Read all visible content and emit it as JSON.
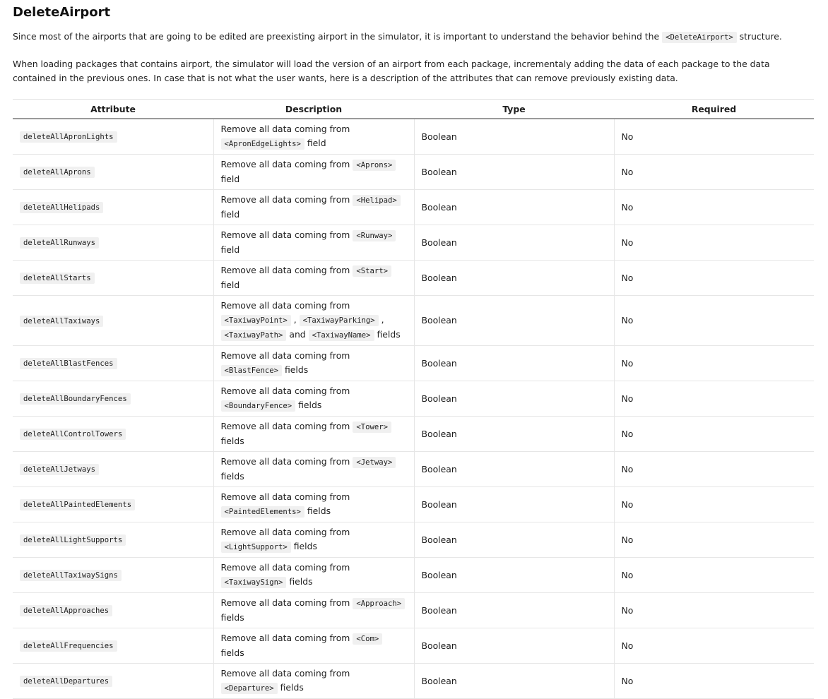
{
  "title": "DeleteAirport",
  "intro": {
    "p1_before": "Since most of the airports that are going to be edited are preexisting airport in the simulator, it is important to understand the behavior behind the ",
    "p1_code": "<DeleteAirport>",
    "p1_after": " structure.",
    "p2": "When loading packages that contains airport, the simulator will load the version of an airport from each package, incrementaly adding the data of each package to the data contained in the previous ones. In case that is not what the user wants, here is a description of the attributes that can remove previously existing data."
  },
  "table": {
    "headers": [
      "Attribute",
      "Description",
      "Type",
      "Required"
    ],
    "rows": [
      {
        "attr": "deleteAllApronLights",
        "desc": [
          {
            "t": "Remove all data coming from "
          },
          {
            "c": "<ApronEdgeLights>"
          },
          {
            "t": " field"
          }
        ],
        "type": "Boolean",
        "req": "No"
      },
      {
        "attr": "deleteAllAprons",
        "desc": [
          {
            "t": "Remove all data coming from "
          },
          {
            "c": "<Aprons>"
          },
          {
            "t": " field"
          }
        ],
        "type": "Boolean",
        "req": "No"
      },
      {
        "attr": "deleteAllHelipads",
        "desc": [
          {
            "t": "Remove all data coming from "
          },
          {
            "c": "<Helipad>"
          },
          {
            "t": " field"
          }
        ],
        "type": "Boolean",
        "req": "No"
      },
      {
        "attr": "deleteAllRunways",
        "desc": [
          {
            "t": "Remove all data coming from "
          },
          {
            "c": "<Runway>"
          },
          {
            "t": " field"
          }
        ],
        "type": "Boolean",
        "req": "No"
      },
      {
        "attr": "deleteAllStarts",
        "desc": [
          {
            "t": "Remove all data coming from "
          },
          {
            "c": "<Start>"
          },
          {
            "t": " field"
          }
        ],
        "type": "Boolean",
        "req": "No"
      },
      {
        "attr": "deleteAllTaxiways",
        "desc": [
          {
            "t": "Remove all data coming from "
          },
          {
            "c": "<TaxiwayPoint>"
          },
          {
            "t": " , "
          },
          {
            "c": "<TaxiwayParking>"
          },
          {
            "t": " , "
          },
          {
            "c": "<TaxiwayPath>"
          },
          {
            "t": " and "
          },
          {
            "c": "<TaxiwayName>"
          },
          {
            "t": " fields"
          }
        ],
        "type": "Boolean",
        "req": "No"
      },
      {
        "attr": "deleteAllBlastFences",
        "desc": [
          {
            "t": "Remove all data coming from "
          },
          {
            "c": "<BlastFence>"
          },
          {
            "t": " fields"
          }
        ],
        "type": "Boolean",
        "req": "No"
      },
      {
        "attr": "deleteAllBoundaryFences",
        "desc": [
          {
            "t": "Remove all data coming from "
          },
          {
            "c": "<BoundaryFence>"
          },
          {
            "t": " fields"
          }
        ],
        "type": "Boolean",
        "req": "No"
      },
      {
        "attr": "deleteAllControlTowers",
        "desc": [
          {
            "t": "Remove all data coming from "
          },
          {
            "c": "<Tower>"
          },
          {
            "t": " fields"
          }
        ],
        "type": "Boolean",
        "req": "No"
      },
      {
        "attr": "deleteAllJetways",
        "desc": [
          {
            "t": "Remove all data coming from "
          },
          {
            "c": "<Jetway>"
          },
          {
            "t": " fields"
          }
        ],
        "type": "Boolean",
        "req": "No"
      },
      {
        "attr": "deleteAllPaintedElements",
        "desc": [
          {
            "t": "Remove all data coming from "
          },
          {
            "c": "<PaintedElements>"
          },
          {
            "t": " fields"
          }
        ],
        "type": "Boolean",
        "req": "No"
      },
      {
        "attr": "deleteAllLightSupports",
        "desc": [
          {
            "t": "Remove all data coming from "
          },
          {
            "c": "<LightSupport>"
          },
          {
            "t": " fields"
          }
        ],
        "type": "Boolean",
        "req": "No"
      },
      {
        "attr": "deleteAllTaxiwaySigns",
        "desc": [
          {
            "t": "Remove all data coming from "
          },
          {
            "c": "<TaxiwaySign>"
          },
          {
            "t": " fields"
          }
        ],
        "type": "Boolean",
        "req": "No"
      },
      {
        "attr": "deleteAllApproaches",
        "desc": [
          {
            "t": "Remove all data coming from "
          },
          {
            "c": "<Approach>"
          },
          {
            "t": " fields"
          }
        ],
        "type": "Boolean",
        "req": "No"
      },
      {
        "attr": "deleteAllFrequencies",
        "desc": [
          {
            "t": "Remove all data coming from "
          },
          {
            "c": "<Com>"
          },
          {
            "t": " fields"
          }
        ],
        "type": "Boolean",
        "req": "No"
      },
      {
        "attr": "deleteAllDepartures",
        "desc": [
          {
            "t": "Remove all data coming from "
          },
          {
            "c": "<Departure>"
          },
          {
            "t": " fields"
          }
        ],
        "type": "Boolean",
        "req": "No"
      }
    ]
  }
}
